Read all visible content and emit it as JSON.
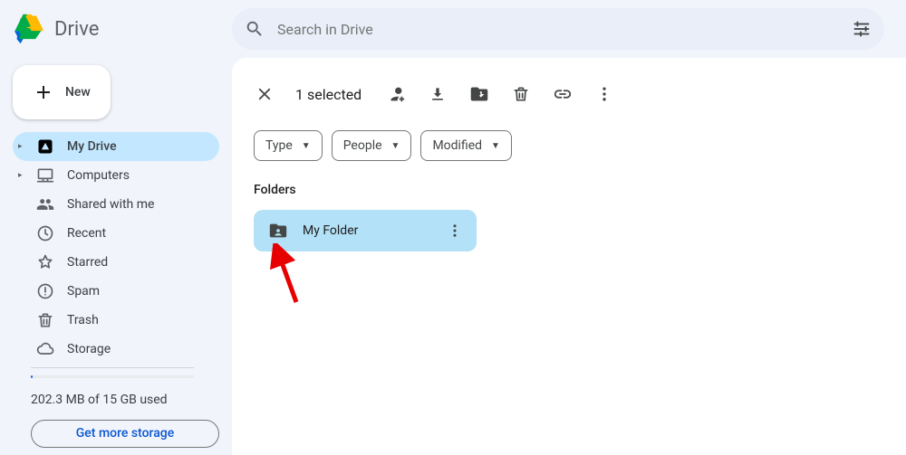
{
  "app": {
    "name": "Drive"
  },
  "search": {
    "placeholder": "Search in Drive"
  },
  "newButton": {
    "label": "New"
  },
  "sidebar": {
    "items": [
      {
        "label": "My Drive"
      },
      {
        "label": "Computers"
      },
      {
        "label": "Shared with me"
      },
      {
        "label": "Recent"
      },
      {
        "label": "Starred"
      },
      {
        "label": "Spam"
      },
      {
        "label": "Trash"
      },
      {
        "label": "Storage"
      }
    ],
    "storage_used_text": "202.3 MB of 15 GB used",
    "storage_fraction": 0.013,
    "storage_button": "Get more storage"
  },
  "toolbar": {
    "selected_text": "1 selected"
  },
  "filters": {
    "type": "Type",
    "people": "People",
    "modified": "Modified"
  },
  "content": {
    "folders_label": "Folders",
    "folders": [
      {
        "name": "My Folder"
      }
    ]
  },
  "annotation": {
    "arrow_color": "#e60000"
  }
}
